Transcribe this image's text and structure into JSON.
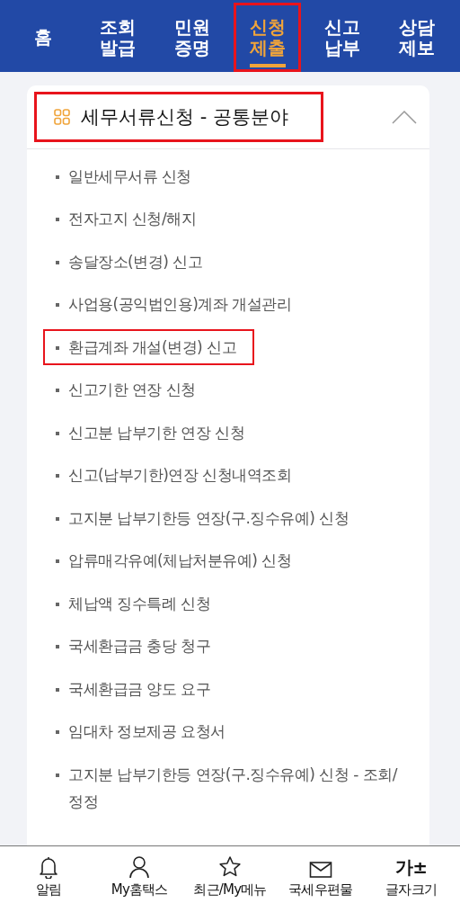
{
  "nav": {
    "tabs": [
      {
        "label": "홈",
        "selected": false,
        "highlighted": false
      },
      {
        "label": "조회 발급",
        "selected": false,
        "highlighted": false
      },
      {
        "label": "민원 증명",
        "selected": false,
        "highlighted": false
      },
      {
        "label": "신청 제출",
        "selected": true,
        "highlighted": true
      },
      {
        "label": "신고 납부",
        "selected": false,
        "highlighted": false
      },
      {
        "label": "상담 제보",
        "selected": false,
        "highlighted": false
      }
    ]
  },
  "section": {
    "title": "세무서류신청 - 공통분야",
    "expanded": true,
    "highlighted": true,
    "items": [
      {
        "label": "일반세무서류 신청",
        "highlighted": false
      },
      {
        "label": "전자고지 신청/해지",
        "highlighted": false
      },
      {
        "label": "송달장소(변경) 신고",
        "highlighted": false
      },
      {
        "label": "사업용(공익법인용)계좌 개설관리",
        "highlighted": false
      },
      {
        "label": "환급계좌 개설(변경) 신고",
        "highlighted": true
      },
      {
        "label": "신고기한 연장 신청",
        "highlighted": false
      },
      {
        "label": "신고분 납부기한 연장 신청",
        "highlighted": false
      },
      {
        "label": "신고(납부기한)연장 신청내역조회",
        "highlighted": false
      },
      {
        "label": "고지분 납부기한등 연장(구.징수유예) 신청",
        "highlighted": false
      },
      {
        "label": "압류매각유예(체납처분유예) 신청",
        "highlighted": false
      },
      {
        "label": "체납액 징수특례 신청",
        "highlighted": false
      },
      {
        "label": "국세환급금 충당 청구",
        "highlighted": false
      },
      {
        "label": "국세환급금 양도 요구",
        "highlighted": false
      },
      {
        "label": "임대차 정보제공 요청서",
        "highlighted": false
      },
      {
        "label": "고지분 납부기한등 연장(구.징수유예) 신청 - 조회/정정",
        "highlighted": false
      }
    ]
  },
  "bottom_bar": {
    "items": [
      {
        "kind": "bell",
        "label": "알림"
      },
      {
        "kind": "person",
        "label": "My홈택스"
      },
      {
        "kind": "star",
        "label": "최근/My메뉴"
      },
      {
        "kind": "mail",
        "label": "국세우편물"
      },
      {
        "kind": "glyph",
        "glyph": "가±",
        "label": "글자크기"
      }
    ]
  }
}
